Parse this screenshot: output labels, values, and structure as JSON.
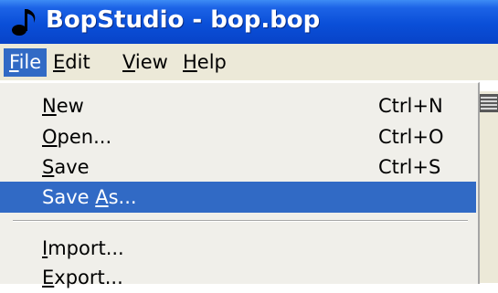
{
  "window": {
    "title": "BopStudio - bop.bop",
    "icon": "music-note-icon",
    "accent_color": "#0a4fd8"
  },
  "menubar": {
    "file": {
      "accel": "F",
      "rest": "ile"
    },
    "edit": {
      "accel": "E",
      "rest": "dit"
    },
    "view": {
      "accel": "V",
      "rest": "iew"
    },
    "help": {
      "accel": "H",
      "rest": "elp"
    }
  },
  "file_menu": {
    "highlight_color": "#316ac5",
    "items": [
      {
        "pre": "",
        "accel": "N",
        "post": "ew",
        "shortcut": "Ctrl+N"
      },
      {
        "pre": "",
        "accel": "O",
        "post": "pen...",
        "shortcut": "Ctrl+O"
      },
      {
        "pre": "",
        "accel": "S",
        "post": "ave",
        "shortcut": "Ctrl+S"
      },
      {
        "pre": "Save ",
        "accel": "A",
        "post": "s...",
        "shortcut": ""
      },
      {
        "pre": "",
        "accel": "I",
        "post": "mport...",
        "shortcut": ""
      },
      {
        "pre": "",
        "accel": "E",
        "post": "xport...",
        "shortcut": ""
      }
    ]
  },
  "side_panel": {
    "icon": "list-view-icon"
  }
}
